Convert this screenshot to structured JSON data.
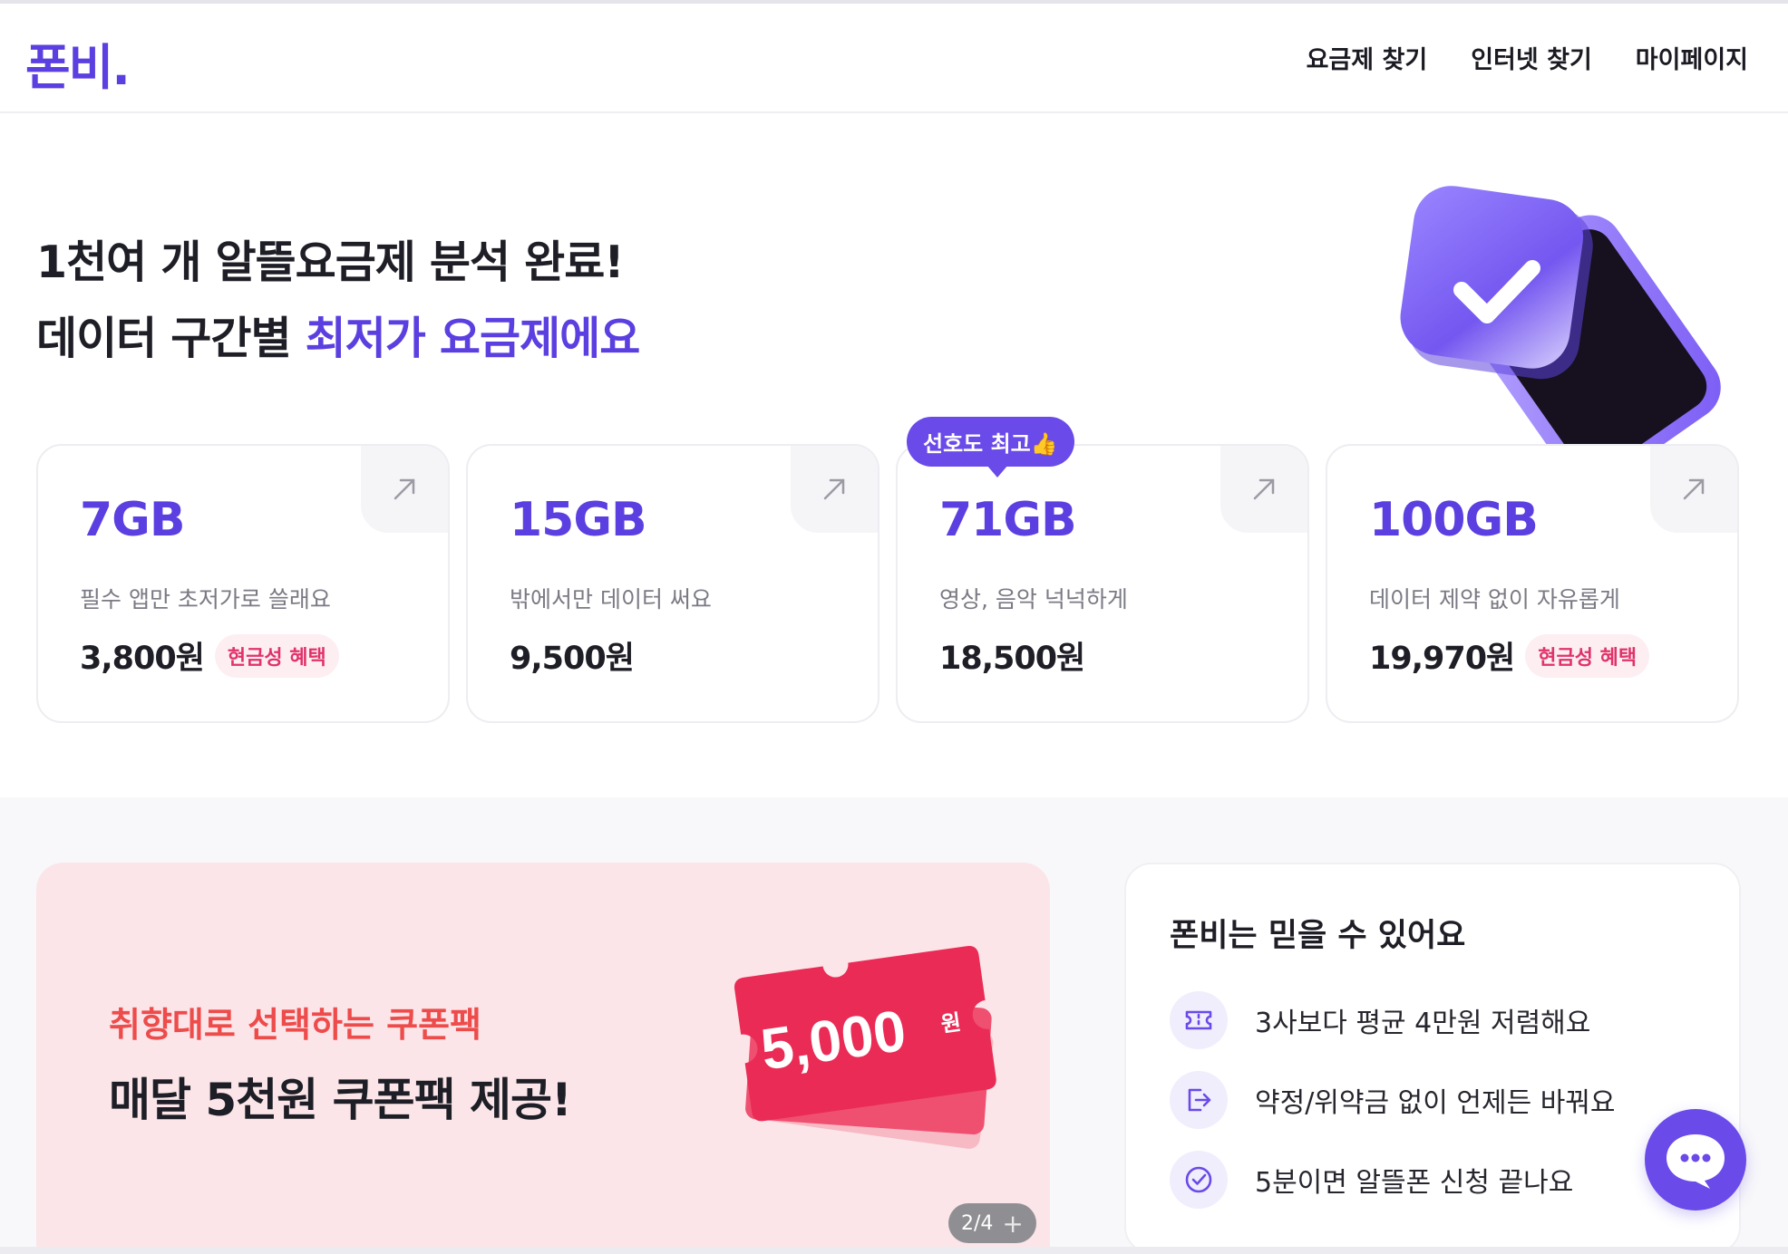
{
  "header": {
    "logo": "폰비.",
    "nav": [
      "요금제 찾기",
      "인터넷 찾기",
      "마이페이지"
    ]
  },
  "hero": {
    "line1": "1천여 개 알뜰요금제 분석 완료!",
    "line2_plain": "데이터 구간별 ",
    "line2_accent": "최저가 요금제에요"
  },
  "plans": {
    "popular_tag": "선호도 최고👍",
    "items": [
      {
        "gb": "7GB",
        "desc": "필수 앱만 초저가로 쓸래요",
        "price": "3,800원",
        "badge": "현금성 혜택"
      },
      {
        "gb": "15GB",
        "desc": "밖에서만 데이터 써요",
        "price": "9,500원",
        "badge": ""
      },
      {
        "gb": "71GB",
        "desc": "영상, 음악 넉넉하게",
        "price": "18,500원",
        "badge": ""
      },
      {
        "gb": "100GB",
        "desc": "데이터 제약 없이 자유롭게",
        "price": "19,970원",
        "badge": "현금성 혜택"
      }
    ]
  },
  "promo": {
    "sub": "취향대로 선택하는 쿠폰팩",
    "main": "매달 5천원 쿠폰팩 제공!",
    "coupon_amount": "5,000",
    "coupon_unit": "원",
    "pager": "2/4",
    "pager_plus": "+"
  },
  "trust": {
    "title": "폰비는 믿을 수 있어요",
    "items": [
      {
        "icon": "ticket-icon",
        "label": "3사보다 평균 4만원 저렴해요"
      },
      {
        "icon": "exit-icon",
        "label": "약정/위약금 없이 언제든 바꿔요"
      },
      {
        "icon": "check-circle-icon",
        "label": "5분이면 알뜰폰 신청 끝나요"
      }
    ]
  },
  "colors": {
    "brand": "#5b3fe0",
    "promo_bg": "#fbe5e8",
    "promo_accent": "#ee4b4b",
    "badge_text": "#e0336a"
  }
}
